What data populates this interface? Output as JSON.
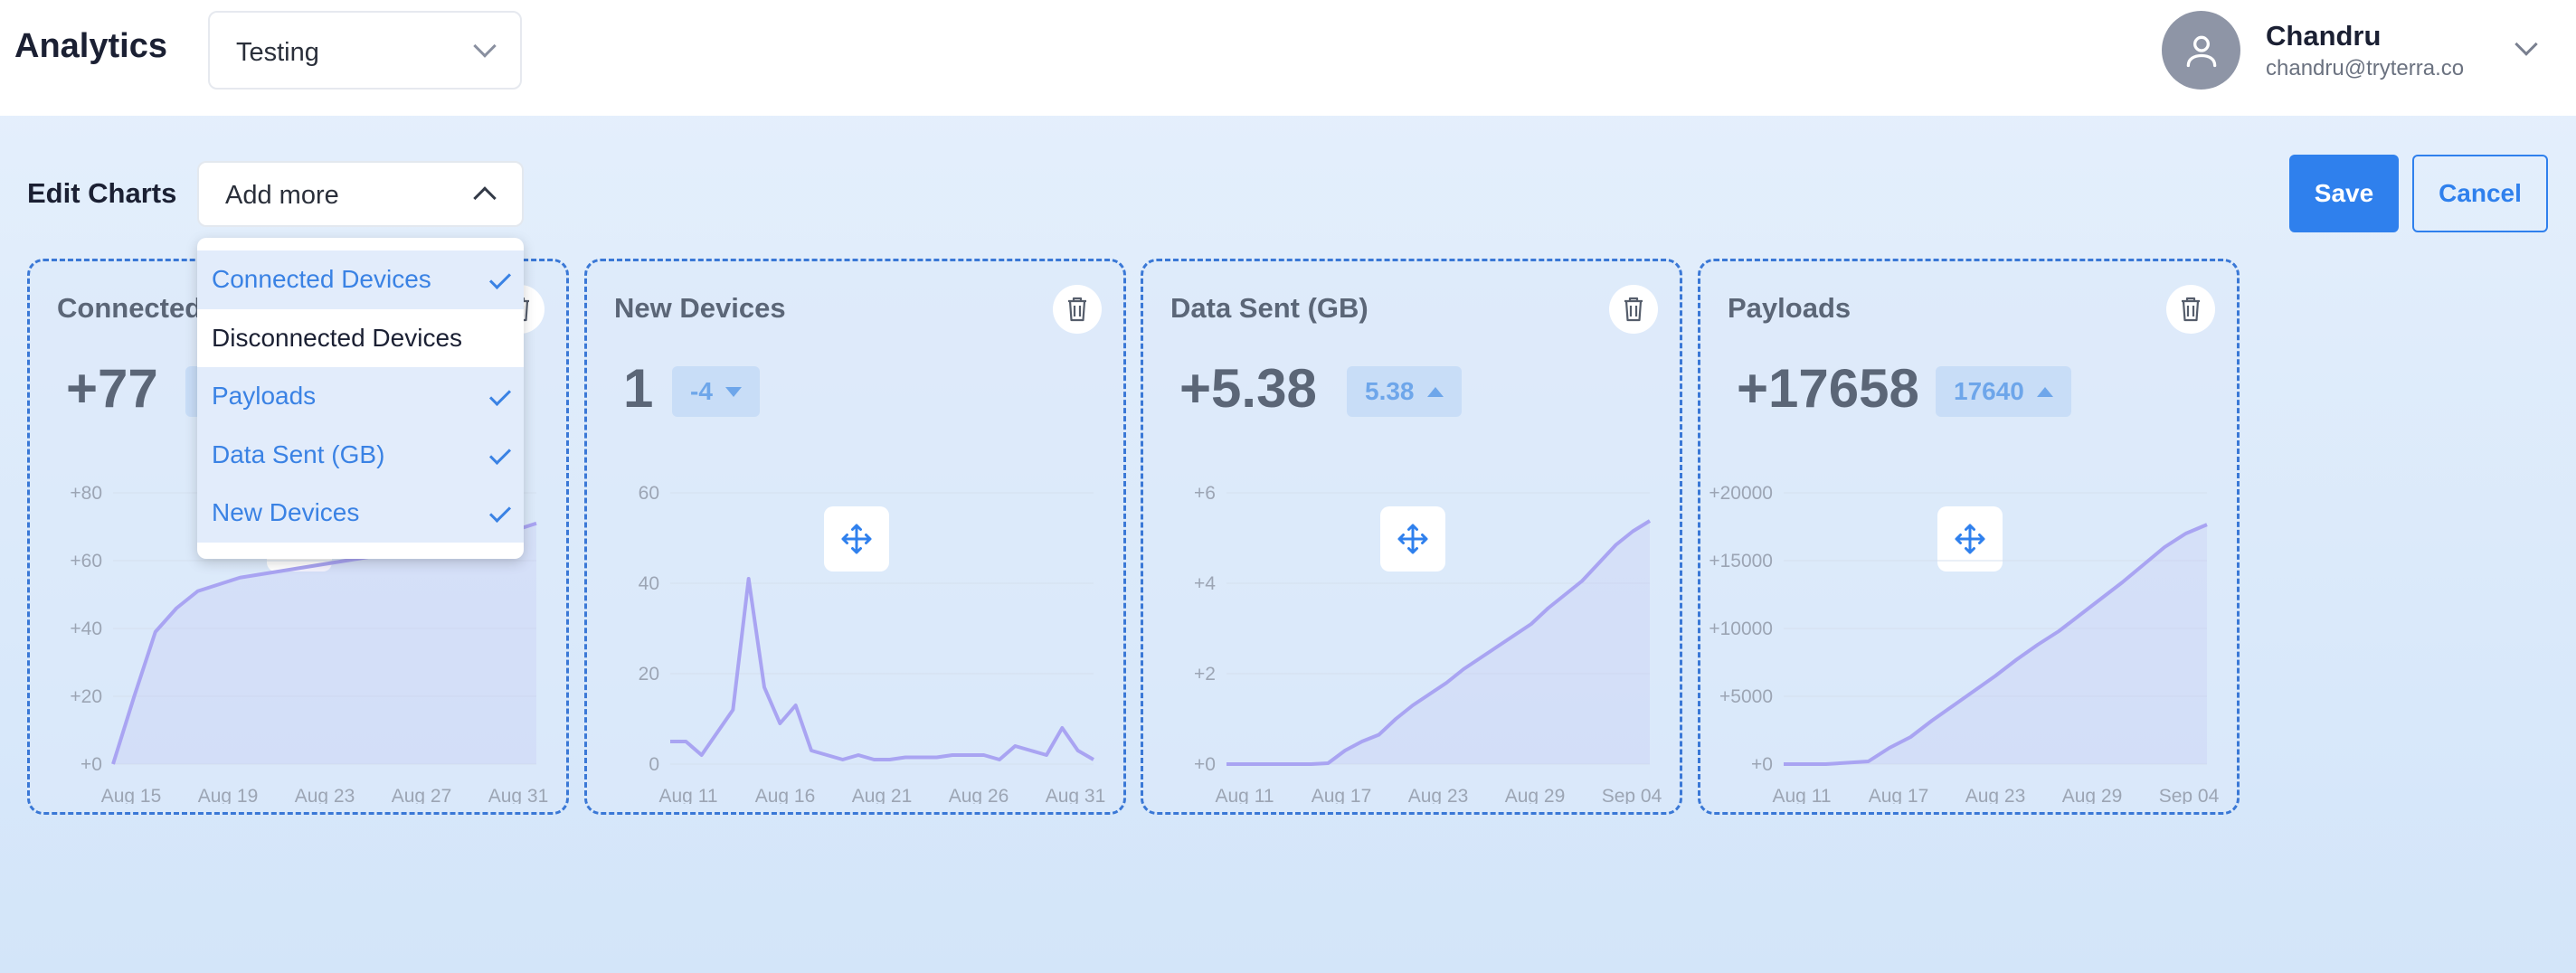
{
  "header": {
    "app_title": "Analytics",
    "project_select": {
      "value": "Testing"
    },
    "user": {
      "name": "Chandru",
      "email": "chandru@tryterra.co"
    }
  },
  "edit_bar": {
    "label": "Edit Charts",
    "add_more_label": "Add more",
    "save_label": "Save",
    "cancel_label": "Cancel"
  },
  "dropdown": {
    "items": [
      {
        "label": "Connected Devices",
        "selected": true
      },
      {
        "label": "Disconnected Devices",
        "selected": false
      },
      {
        "label": "Payloads",
        "selected": true
      },
      {
        "label": "Data Sent (GB)",
        "selected": true
      },
      {
        "label": "New Devices",
        "selected": true
      }
    ]
  },
  "colors": {
    "accent": "#2f80ed",
    "line": "#a9a4f2",
    "card_border": "#3a78d6",
    "badge_bg": "#c8ddf7",
    "badge_text": "#6ea6ea"
  },
  "cards": [
    {
      "title": "Connected Devices",
      "metric": "+77",
      "badge": "",
      "trend": "up"
    },
    {
      "title": "New Devices",
      "metric": "1",
      "badge": "-4",
      "trend": "down"
    },
    {
      "title": "Data Sent (GB)",
      "metric": "+5.38",
      "badge": "5.38",
      "trend": "up"
    },
    {
      "title": "Payloads",
      "metric": "+17658",
      "badge": "17640",
      "trend": "up"
    }
  ],
  "chart_data": [
    {
      "type": "area",
      "title": "Connected Devices",
      "x_ticks": [
        "Aug 15",
        "Aug 19",
        "Aug 23",
        "Aug 27",
        "Aug 31"
      ],
      "y_ticks": [
        "+0",
        "+20",
        "+40",
        "+60",
        "+80"
      ],
      "ylim": [
        0,
        80
      ],
      "series": [
        {
          "values": [
            0,
            20,
            39,
            46,
            51,
            53,
            55,
            56,
            57,
            58,
            59,
            60,
            61,
            62,
            63,
            64,
            65,
            66,
            67,
            69,
            71
          ]
        }
      ]
    },
    {
      "type": "line",
      "title": "New Devices",
      "x_ticks": [
        "Aug 11",
        "Aug 16",
        "Aug 21",
        "Aug 26",
        "Aug 31"
      ],
      "y_ticks": [
        "0",
        "20",
        "40",
        "60"
      ],
      "ylim": [
        0,
        60
      ],
      "series": [
        {
          "values": [
            5,
            5,
            2,
            7,
            12,
            41,
            17,
            9,
            13,
            3,
            2,
            1,
            2,
            1,
            1,
            1.5,
            1.5,
            1.5,
            2,
            2,
            2,
            1,
            4,
            3,
            2,
            8,
            3,
            1
          ]
        }
      ]
    },
    {
      "type": "area",
      "title": "Data Sent (GB)",
      "x_ticks": [
        "Aug 11",
        "Aug 17",
        "Aug 23",
        "Aug 29",
        "Sep 04"
      ],
      "y_ticks": [
        "+0",
        "+2",
        "+4",
        "+6"
      ],
      "ylim": [
        0,
        6
      ],
      "series": [
        {
          "values": [
            0,
            0,
            0,
            0,
            0,
            0,
            0.02,
            0.3,
            0.5,
            0.65,
            1,
            1.3,
            1.55,
            1.8,
            2.1,
            2.35,
            2.6,
            2.85,
            3.1,
            3.45,
            3.75,
            4.05,
            4.45,
            4.85,
            5.15,
            5.38
          ]
        }
      ]
    },
    {
      "type": "area",
      "title": "Payloads",
      "x_ticks": [
        "Aug 11",
        "Aug 17",
        "Aug 23",
        "Aug 29",
        "Sep 04"
      ],
      "y_ticks": [
        "+0",
        "+5000",
        "+10000",
        "+15000",
        "+20000"
      ],
      "ylim": [
        0,
        20000
      ],
      "series": [
        {
          "values": [
            0,
            0,
            0,
            100,
            200,
            1200,
            2000,
            3200,
            4300,
            5400,
            6500,
            7700,
            8800,
            9800,
            11000,
            12200,
            13400,
            14700,
            16000,
            17000,
            17658
          ]
        }
      ]
    }
  ]
}
